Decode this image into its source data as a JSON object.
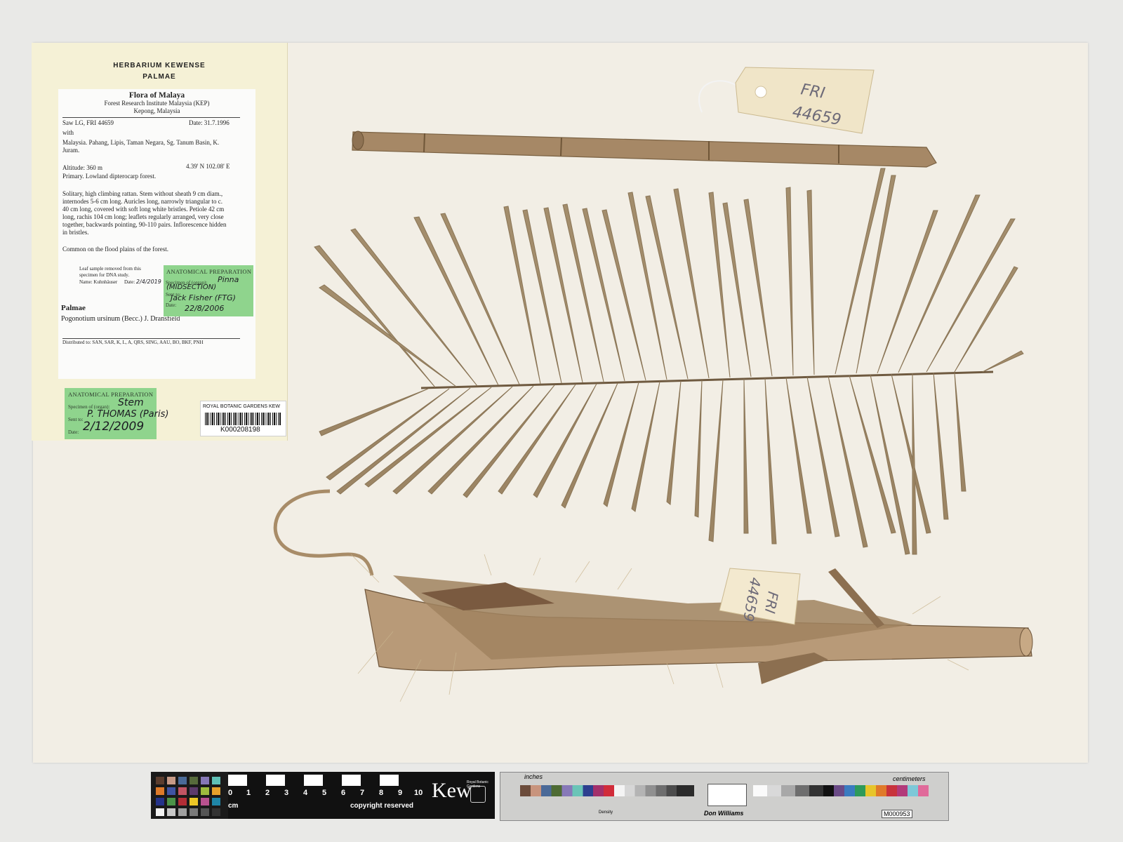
{
  "folder_label": {
    "line1": "HERBARIUM KEWENSE",
    "line2": "PALMAE"
  },
  "data_label": {
    "title": "Flora of Malaya",
    "institute": "Forest Research Institute Malaysia (KEP)",
    "location": "Kepong, Malaysia",
    "collector": "Saw LG, FRI 44659",
    "date": "Date: 31.7.1996",
    "with": "with",
    "locality_1": "Malaysia. Pahang, Lipis, Taman Negara, Sg. Tanum Basin, K.",
    "locality_2": "Juram.",
    "altitude": "Altitude: 360 m",
    "coordinates": "4.39' N  102.08' E",
    "habitat": "Primary. Lowland dipterocarp forest.",
    "description": [
      "Solitary, high climbing rattan. Stem without sheath 9 cm diam.,",
      "internodes 5-6 cm long. Auricles long, narrowly triangular to c.",
      "40 cm long, covered with soft long white bristles. Petiole 42 cm",
      "long, rachis 104 cm long; leaflets regularly arranged, very close",
      "together, backwards pointing, 90-110 pairs. Inflorescence hidden",
      "in bristles."
    ],
    "note": "Common on the flood plains of the forest.",
    "dna_1": "Leaf sample removed from this",
    "dna_2": "specimen for DNA study.",
    "dna_name": "Name: Kuhnhäuser",
    "dna_date_label": "Date:",
    "dna_date": "2/4/2019",
    "family": "Palmae",
    "species": "Pogonotium ursinum (Becc.) J. Dransfield",
    "distributed": "Distributed to: SAN, SAR, K, L, A, QRS, SING, AAU, BO, BKF, PNH"
  },
  "anatomical_1": {
    "heading": "ANATOMICAL PREPARATION",
    "specimen_label": "Specimen of (organ):",
    "specimen_value": "Pinna",
    "specimen_note": "(MIDSECTION)",
    "sent_label": "Sent to:",
    "sent_value": "Jack Fisher (FTG)",
    "date_label": "Date:",
    "date_value": "22/8/2006"
  },
  "anatomical_2": {
    "heading": "ANATOMICAL PREPARATION",
    "specimen_label": "Specimen of (organ):",
    "specimen_value": "Stem",
    "sent_label": "Sent to:",
    "sent_value": "P. THOMAS (Paris)",
    "date_label": "Date:",
    "date_value": "2/12/2009"
  },
  "barcode": {
    "org": "ROYAL BOTANIC GARDENS KEW",
    "number": "K000208198"
  },
  "tags": {
    "top_line1": "FRI",
    "top_line2": "44659",
    "bottom_line1": "FRI",
    "bottom_line2": "44659"
  },
  "ruler": {
    "numbers": [
      "0",
      "1",
      "2",
      "3",
      "4",
      "5",
      "6",
      "7",
      "8",
      "9",
      "10"
    ],
    "unit": "cm",
    "copyright": "copyright reserved",
    "brand": "Kew",
    "brand_sub": "Royal Botanic Gardens"
  },
  "color_card": {
    "inches": "inches",
    "centimeters": "centimeters",
    "maker": "Don Williams",
    "code": "M000953",
    "density": "Density"
  },
  "colors": {
    "sheet": "#f2eee5",
    "folder": "#f5f1d6",
    "green_label": "#8fd48d",
    "dry_leaf": "#8a7556",
    "stem": "#a68866"
  }
}
